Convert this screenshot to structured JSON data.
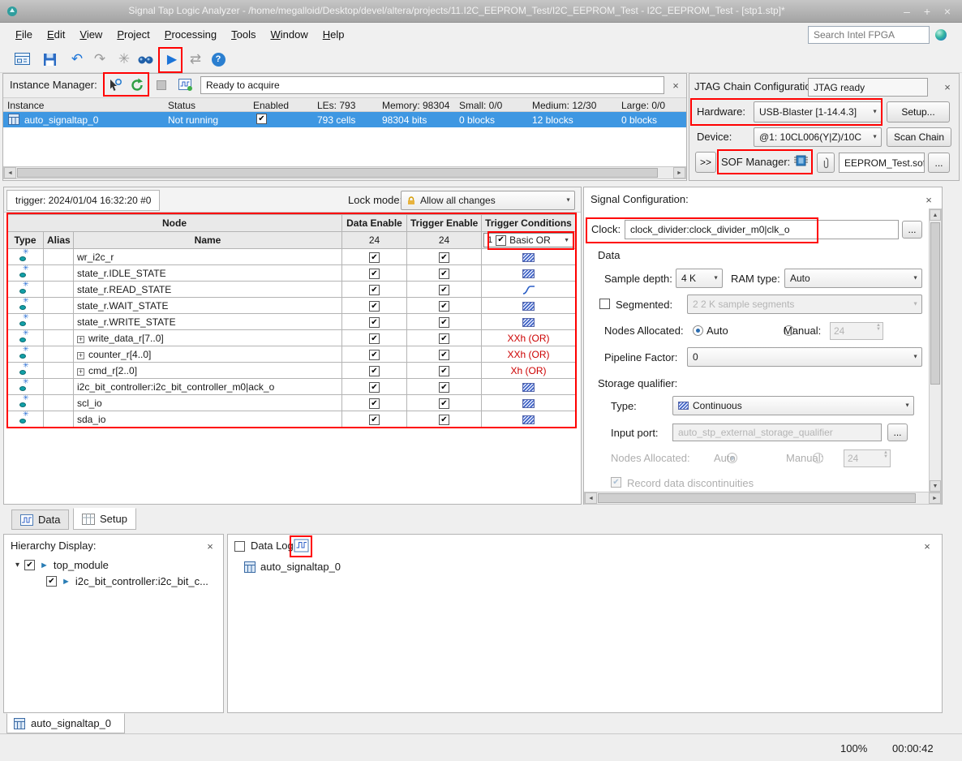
{
  "colors": {
    "annotation": "#ff0000",
    "selection_blue": "#3e97e2",
    "condition_red": "#cc0000"
  },
  "icons": {
    "undo": "↶",
    "redo": "↷",
    "play": "▶",
    "sync": "⇄",
    "snowflake": "✳",
    "help_mark": "?",
    "dropdown": "▼",
    "check": "✔",
    "node_star": "✳",
    "win_min": "–",
    "win_max": "+",
    "win_close": "×",
    "panel_close": "×",
    "left_arrow": "◄",
    "right_arrow": "►",
    "up_arrow": "▲",
    "down_arrow": "▼",
    "tree_expander": "▾",
    "tree_item": "►",
    "ellipsis": "..."
  },
  "window": {
    "title": "Signal Tap Logic Analyzer - /home/megalloid/Desktop/devel/altera/projects/11.I2C_EEPROM_Test/I2C_EEPROM_Test - I2C_EEPROM_Test - [stp1.stp]*"
  },
  "menu": {
    "items": [
      "File",
      "Edit",
      "View",
      "Project",
      "Processing",
      "Tools",
      "Window",
      "Help"
    ],
    "search_placeholder": "Search Intel FPGA"
  },
  "instance_manager": {
    "title": "Instance Manager:",
    "status": "Ready to acquire",
    "columns": [
      "Instance",
      "Status",
      "Enabled",
      "LEs: 793",
      "Memory: 98304",
      "Small: 0/0",
      "Medium: 12/30",
      "Large: 0/0"
    ],
    "row": {
      "instance": "auto_signaltap_0",
      "status": "Not running",
      "enabled": true,
      "les": "793 cells",
      "memory": "98304 bits",
      "small": "0 blocks",
      "medium": "12 blocks",
      "large": "0 blocks"
    }
  },
  "jtag": {
    "title": "JTAG Chain Configuration:",
    "status": "JTAG ready",
    "hardware_label": "Hardware:",
    "hardware_value": "USB-Blaster [1-14.4.3]",
    "setup_button": "Setup...",
    "device_label": "Device:",
    "device_value": "@1: 10CL006(Y|Z)/10C",
    "scan_chain_button": "Scan Chain",
    "expand_button": ">>",
    "sof_manager_label": "SOF Manager:",
    "sof_file": "EEPROM_Test.sof"
  },
  "setup_view": {
    "trigger_tab": "trigger: 2024/01/04 16:32:20  #0",
    "lock_mode_label": "Lock mode:",
    "lock_mode_value": "Allow all changes",
    "table": {
      "node_header": "Node",
      "col_type": "Type",
      "col_alias": "Alias",
      "col_name": "Name",
      "data_enable_header": "Data Enable",
      "trigger_enable_header": "Trigger Enable",
      "trigger_conditions_header": "Trigger Conditions",
      "data_enable_count": "24",
      "trigger_enable_count": "24",
      "condition_number": "1",
      "condition_mode": "Basic OR",
      "rows": [
        {
          "name": "wr_i2c_r",
          "condition": "pattern",
          "expandable": false
        },
        {
          "name": "state_r.IDLE_STATE",
          "condition": "pattern",
          "expandable": false
        },
        {
          "name": "state_r.READ_STATE",
          "condition": "edge",
          "expandable": false
        },
        {
          "name": "state_r.WAIT_STATE",
          "condition": "pattern",
          "expandable": false
        },
        {
          "name": "state_r.WRITE_STATE",
          "condition": "pattern",
          "expandable": false
        },
        {
          "name": "write_data_r[7..0]",
          "condition": "XXh (OR)",
          "expandable": true
        },
        {
          "name": "counter_r[4..0]",
          "condition": "XXh (OR)",
          "expandable": true
        },
        {
          "name": "cmd_r[2..0]",
          "condition": "Xh (OR)",
          "expandable": true
        },
        {
          "name": "i2c_bit_controller:i2c_bit_controller_m0|ack_o",
          "condition": "pattern",
          "expandable": false
        },
        {
          "name": "scl_io",
          "condition": "pattern",
          "expandable": false
        },
        {
          "name": "sda_io",
          "condition": "pattern",
          "expandable": false
        }
      ]
    }
  },
  "signal_config": {
    "title": "Signal Configuration:",
    "clock_label": "Clock:",
    "clock_value": "clock_divider:clock_divider_m0|clk_o",
    "data_section": "Data",
    "sample_depth_label": "Sample depth:",
    "sample_depth_value": "4 K",
    "ram_type_label": "RAM type:",
    "ram_type_value": "Auto",
    "segmented_label": "Segmented:",
    "segmented_value": "2  2 K sample segments",
    "nodes_allocated_label": "Nodes Allocated:",
    "auto_label": "Auto",
    "manual_label": "Manual:",
    "manual_value": "24",
    "pipeline_label": "Pipeline Factor:",
    "pipeline_value": "0",
    "storage_section": "Storage qualifier:",
    "type_label": "Type:",
    "type_value": "Continuous",
    "input_port_label": "Input port:",
    "input_port_value": "auto_stp_external_storage_qualifier",
    "manual_value2": "24",
    "record_label": "Record data discontinuities"
  },
  "view_tabs": {
    "data": "Data",
    "setup": "Setup"
  },
  "hierarchy": {
    "title": "Hierarchy Display:",
    "items": [
      {
        "label": "top_module",
        "checked": true
      },
      {
        "label": "i2c_bit_controller:i2c_bit_c...",
        "checked": true
      }
    ]
  },
  "data_log": {
    "label": "Data Log:",
    "item": "auto_signaltap_0"
  },
  "bottom_tab": "auto_signaltap_0",
  "status_bar": {
    "zoom": "100%",
    "time": "00:00:42"
  }
}
